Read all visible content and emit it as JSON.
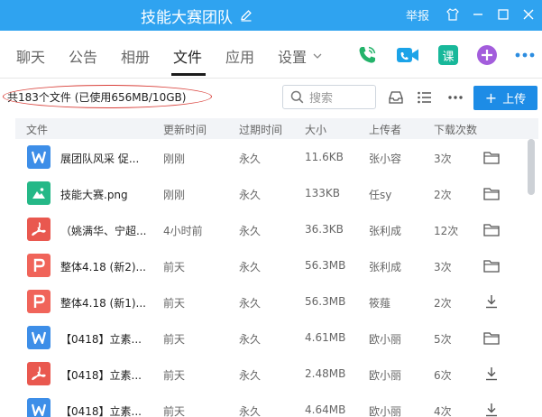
{
  "titlebar": {
    "title": "技能大赛团队",
    "report": "举报",
    "bg": "#2fa3f0"
  },
  "nav": {
    "tabs": [
      {
        "label": "聊天"
      },
      {
        "label": "公告"
      },
      {
        "label": "相册"
      },
      {
        "label": "文件",
        "active": true
      },
      {
        "label": "应用"
      },
      {
        "label": "设置"
      }
    ],
    "icons": [
      "phone-icon",
      "video-call-icon",
      "course-icon",
      "add-app-icon",
      "more-icon"
    ],
    "course_label": "课"
  },
  "toolbar": {
    "summary": "共183个文件 (已使用656MB/10GB)",
    "search_placeholder": "搜索",
    "upload_label": "上传",
    "accent": "#1d8ce6"
  },
  "table": {
    "headers": [
      "文件",
      "更新时间",
      "过期时间",
      "大小",
      "上传者",
      "下载次数"
    ],
    "rows": [
      {
        "type": "word",
        "name": "展团队风采 促...",
        "updated": "刚刚",
        "expires": "永久",
        "size": "11.6KB",
        "uploader": "张小容",
        "downloads": "3次",
        "action": "folder-icon"
      },
      {
        "type": "image",
        "name": "技能大赛.png",
        "updated": "刚刚",
        "expires": "永久",
        "size": "133KB",
        "uploader": "任sy",
        "downloads": "2次",
        "action": "folder-icon"
      },
      {
        "type": "pdf",
        "name": "（姚满华、宁超...",
        "updated": "4小时前",
        "expires": "永久",
        "size": "36.3KB",
        "uploader": "张利成",
        "downloads": "12次",
        "action": "folder-icon"
      },
      {
        "type": "ppt",
        "name": "整体4.18 (新2)...",
        "updated": "前天",
        "expires": "永久",
        "size": "56.3MB",
        "uploader": "张利成",
        "downloads": "3次",
        "action": "folder-icon"
      },
      {
        "type": "ppt",
        "name": "整体4.18 (新1)...",
        "updated": "前天",
        "expires": "永久",
        "size": "56.3MB",
        "uploader": "筱薤",
        "downloads": "2次",
        "action": "download-icon"
      },
      {
        "type": "word",
        "name": "【0418】立素...",
        "updated": "前天",
        "expires": "永久",
        "size": "4.61MB",
        "uploader": "欧小丽",
        "downloads": "5次",
        "action": "folder-icon"
      },
      {
        "type": "pdf",
        "name": "【0418】立素...",
        "updated": "前天",
        "expires": "永久",
        "size": "2.48MB",
        "uploader": "欧小丽",
        "downloads": "6次",
        "action": "download-icon"
      },
      {
        "type": "word",
        "name": "【0418】立素...",
        "updated": "前天",
        "expires": "永久",
        "size": "4.64MB",
        "uploader": "欧小丽",
        "downloads": "4次",
        "action": "download-icon"
      }
    ]
  },
  "colors": {
    "word": "#3d8ee8",
    "image": "#25b887",
    "pdf": "#e9584f",
    "ppt": "#f0645a",
    "highlight": "#d9403a"
  }
}
